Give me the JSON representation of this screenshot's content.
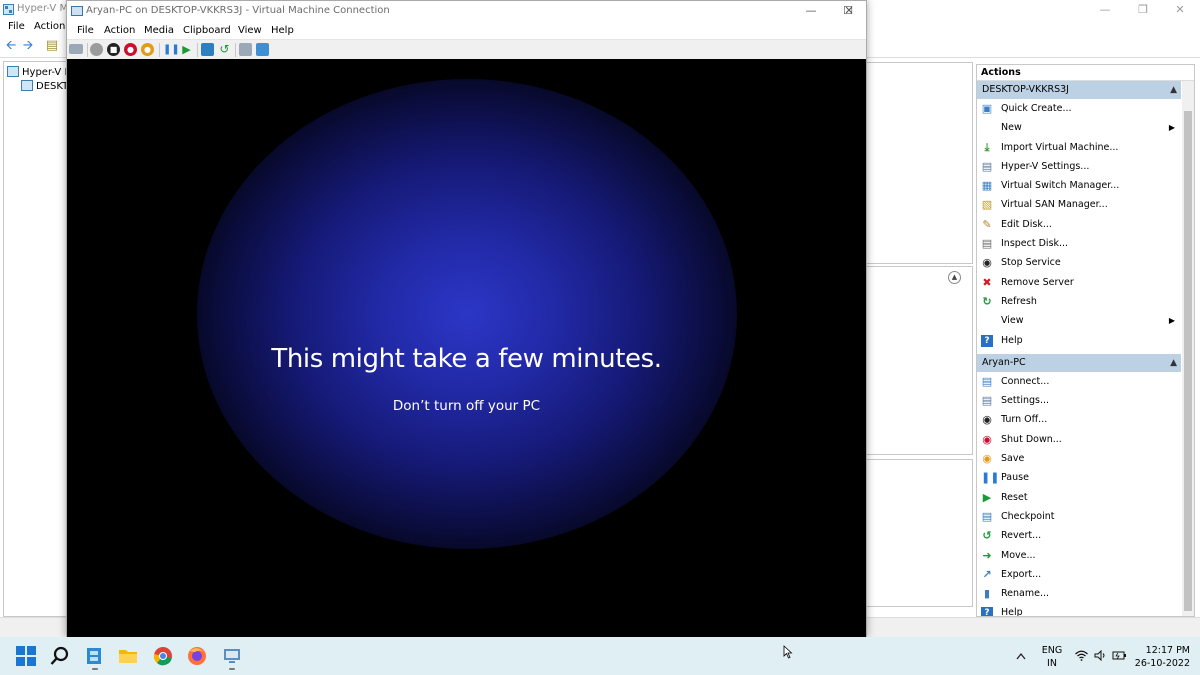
{
  "hyperv": {
    "title": "Hyper-V Ma",
    "menu": [
      "File",
      "Action"
    ],
    "tree": [
      "Hyper-V M",
      "DESKTO"
    ],
    "actions": {
      "header": "Actions",
      "host_section": {
        "title": "DESKTOP-VKKRS3J",
        "items": [
          {
            "label": "Quick Create...",
            "icon": "quick-create-icon"
          },
          {
            "label": "New",
            "icon": "",
            "submenu": true
          },
          {
            "label": "Import Virtual Machine...",
            "icon": "import-icon"
          },
          {
            "label": "Hyper-V Settings...",
            "icon": "settings-page-icon"
          },
          {
            "label": "Virtual Switch Manager...",
            "icon": "switch-icon"
          },
          {
            "label": "Virtual SAN Manager...",
            "icon": "san-icon"
          },
          {
            "label": "Edit Disk...",
            "icon": "edit-disk-icon"
          },
          {
            "label": "Inspect Disk...",
            "icon": "inspect-disk-icon"
          },
          {
            "label": "Stop Service",
            "icon": "stop-icon"
          },
          {
            "label": "Remove Server",
            "icon": "remove-icon"
          },
          {
            "label": "Refresh",
            "icon": "refresh-icon"
          },
          {
            "label": "View",
            "icon": "",
            "submenu": true
          },
          {
            "label": "Help",
            "icon": "help-icon"
          }
        ]
      },
      "vm_section": {
        "title": "Aryan-PC",
        "items": [
          {
            "label": "Connect...",
            "icon": "connect-icon"
          },
          {
            "label": "Settings...",
            "icon": "settings-page-icon"
          },
          {
            "label": "Turn Off...",
            "icon": "turn-off-icon"
          },
          {
            "label": "Shut Down...",
            "icon": "shutdown-icon"
          },
          {
            "label": "Save",
            "icon": "save-icon"
          },
          {
            "label": "Pause",
            "icon": "pause-icon"
          },
          {
            "label": "Reset",
            "icon": "reset-icon"
          },
          {
            "label": "Checkpoint",
            "icon": "checkpoint-icon"
          },
          {
            "label": "Revert...",
            "icon": "revert-icon"
          },
          {
            "label": "Move...",
            "icon": "move-icon"
          },
          {
            "label": "Export...",
            "icon": "export-icon"
          },
          {
            "label": "Rename...",
            "icon": "rename-icon"
          },
          {
            "label": "Help",
            "icon": "help-icon"
          }
        ]
      }
    }
  },
  "vm": {
    "title": "Aryan-PC on DESKTOP-VKKRS3J - Virtual Machine Connection",
    "menu": [
      "File",
      "Action",
      "Media",
      "Clipboard",
      "View",
      "Help"
    ],
    "screen_message": "This might take a few minutes.",
    "screen_submessage": "Don’t turn off your PC"
  },
  "taskbar": {
    "language": "ENG",
    "region": "IN",
    "time": "12:17 PM",
    "date": "26-10-2022"
  },
  "colors": {
    "section_header": "#bcd1e4",
    "taskbar": "#dfeff4",
    "vm_glow": "#2b36c6"
  }
}
